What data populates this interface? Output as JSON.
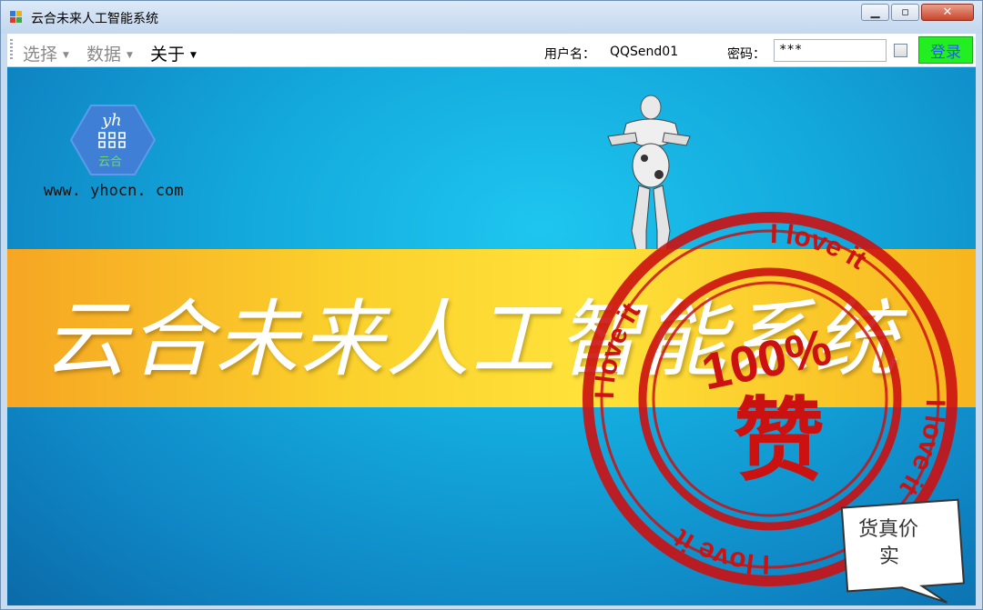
{
  "window": {
    "title": "云合未来人工智能系统"
  },
  "menu": {
    "items": [
      {
        "label": "选择",
        "color": "#8a8a8a"
      },
      {
        "label": "数据",
        "color": "#8a8a8a"
      },
      {
        "label": "关于",
        "color": "#000000"
      }
    ]
  },
  "login": {
    "username_label": "用户名：",
    "username_value": "QQSend01",
    "password_label": "密码：",
    "password_value": "***",
    "login_button": "登录"
  },
  "banner": {
    "logo_text": "yh",
    "logo_sub": "云合",
    "url": "www. yhocn. com",
    "headline": "云合未来人工智能系统"
  },
  "stamp": {
    "ring_text": "I love it",
    "percent": "100%",
    "word": "赞"
  },
  "bubble": {
    "line1": "货真价",
    "line2": "实"
  },
  "colors": {
    "login_bg": "#22ee22",
    "stamp": "#cc1111",
    "band": "#fbd12c"
  }
}
